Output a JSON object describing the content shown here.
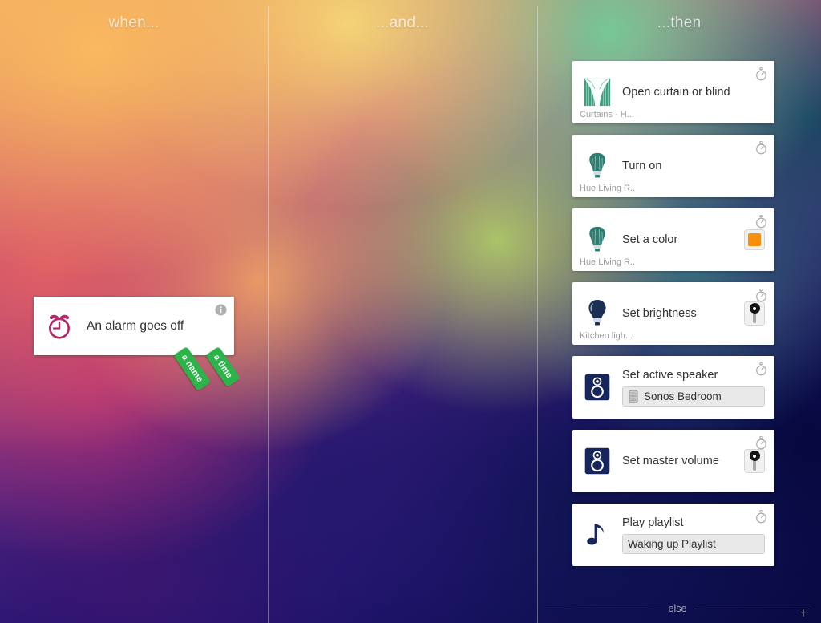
{
  "columns": {
    "when_label": "when...",
    "and_label": "...and...",
    "then_label": "...then"
  },
  "when": {
    "card": {
      "title": "An alarm goes off",
      "icon": "alarm-clock-icon",
      "icon_color": "#b5296a",
      "info_icon": "info-icon"
    },
    "tags": [
      {
        "label": "a name"
      },
      {
        "label": "a time"
      }
    ],
    "tag_color": "#2cb34a"
  },
  "then": {
    "cards": [
      {
        "title": "Open curtain or blind",
        "subtitle": "Curtains - H...",
        "icon": "curtain-icon",
        "widget": "none",
        "timer_icon": "stopwatch-icon"
      },
      {
        "title": "Turn on",
        "subtitle": "Hue Living R..",
        "icon": "bulb-teal-icon",
        "widget": "none",
        "timer_icon": "stopwatch-icon"
      },
      {
        "title": "Set a color",
        "subtitle": "Hue Living R..",
        "icon": "bulb-teal-icon",
        "widget": "color-swatch",
        "swatch_color": "#f98e0b",
        "timer_icon": "stopwatch-icon"
      },
      {
        "title": "Set brightness",
        "subtitle": "Kitchen ligh...",
        "icon": "bulb-navy-icon",
        "widget": "slider",
        "timer_icon": "stopwatch-icon"
      },
      {
        "title": "Set active speaker",
        "subtitle": "",
        "icon": "speaker-icon",
        "widget": "field",
        "field_value": "Sonos Bedroom",
        "field_icon": "sonos-speaker-icon",
        "timer_icon": "stopwatch-icon"
      },
      {
        "title": "Set master volume",
        "subtitle": "",
        "icon": "speaker-icon",
        "widget": "slider",
        "timer_icon": "stopwatch-icon"
      },
      {
        "title": "Play playlist",
        "subtitle": "",
        "icon": "music-note-icon",
        "widget": "field",
        "field_value": "Waking up Playlist",
        "field_icon": "none",
        "timer_icon": "stopwatch-icon"
      }
    ],
    "else_label": "else",
    "add_label": "+"
  }
}
